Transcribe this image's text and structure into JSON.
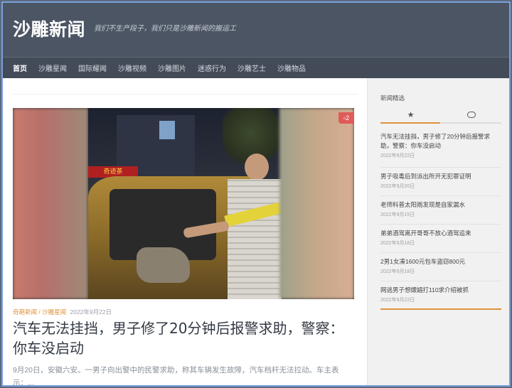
{
  "site": {
    "title": "沙雕新闻",
    "tagline": "我们不生产段子，我们只是沙雕新闻的搬运工"
  },
  "nav": {
    "items": [
      {
        "label": "首页",
        "active": true
      },
      {
        "label": "沙雕星闻",
        "active": false
      },
      {
        "label": "国际耀闻",
        "active": false
      },
      {
        "label": "沙雕视频",
        "active": false
      },
      {
        "label": "沙雕图片",
        "active": false
      },
      {
        "label": "迷惑行为",
        "active": false
      },
      {
        "label": "沙雕艺士",
        "active": false
      },
      {
        "label": "沙雕物品",
        "active": false
      }
    ]
  },
  "post": {
    "comment_count": "2",
    "comment_icon": "comment-icon",
    "image_sign_text": "奇迹茶",
    "category_1": "奇葩新闻",
    "separator": " / ",
    "category_2": "沙雕星闻",
    "date": "2022年9月22日",
    "title": "汽车无法挂挡，男子修了20分钟后报警求助，警察：你车没启动",
    "excerpt": "9月20日，安徽六安。一男子向出警中的民警求助，称其车辆发生故障，汽车档杆无法拉动。车主表示：..."
  },
  "sidebar": {
    "title": "新闻精选",
    "tabs": [
      {
        "icon": "star-icon",
        "glyph": "★"
      },
      {
        "icon": "comments-icon",
        "glyph": "🗨"
      }
    ],
    "news": [
      {
        "title": "汽车无法挂挡，男子修了20分钟后报警求助，警察：你车没启动",
        "date": "2022年9月22日"
      },
      {
        "title": "男子吸毒后到派出所开无犯罪证明",
        "date": "2022年9月20日"
      },
      {
        "title": "老师科普太阳雨发现是自家漏水",
        "date": "2022年9月15日"
      },
      {
        "title": "弟弟酒驾离开哥哥不放心酒驾追来",
        "date": "2022年9月18日"
      },
      {
        "title": "2男1女凑1600元包车盗窃800元",
        "date": "2022年9月18日"
      },
      {
        "title": "网逃男子想嫖娼打110求介绍被抓",
        "date": "2022年9月22日"
      }
    ]
  },
  "colors": {
    "header_bg": "#4c5564",
    "accent": "#e0923a",
    "badge": "#e05a5a"
  }
}
